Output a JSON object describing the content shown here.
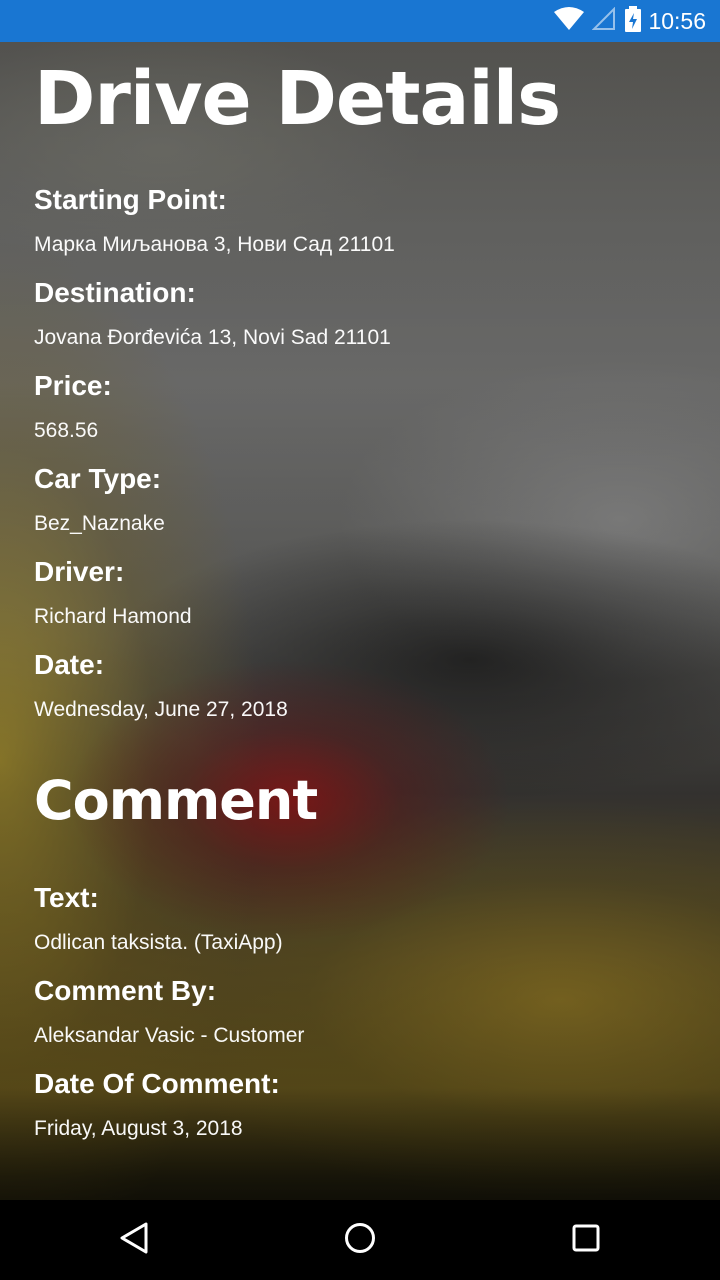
{
  "status_bar": {
    "time": "10:56",
    "icons": [
      "wifi-icon",
      "cellular-signal-icon",
      "battery-charging-icon"
    ]
  },
  "page": {
    "title": "Drive Details"
  },
  "drive": {
    "starting_point": {
      "label": "Starting Point:",
      "value": "Марка Миљанова 3, Нови Сад 21101"
    },
    "destination": {
      "label": "Destination:",
      "value": "Jovana Đorđevića 13, Novi Sad 21101"
    },
    "price": {
      "label": "Price:",
      "value": "568.56"
    },
    "car_type": {
      "label": "Car Type:",
      "value": "Bez_Naznake"
    },
    "driver": {
      "label": "Driver:",
      "value": "Richard Hamond"
    },
    "date": {
      "label": "Date:",
      "value": "Wednesday, June 27, 2018"
    }
  },
  "comment": {
    "title": "Comment",
    "text": {
      "label": "Text:",
      "value": "Odlican taksista. (TaxiApp)"
    },
    "by": {
      "label": "Comment By:",
      "value": "Aleksandar Vasic - Customer"
    },
    "date": {
      "label": "Date Of Comment:",
      "value": "Friday, August 3, 2018"
    }
  },
  "nav_bar": {
    "icons": [
      "back-icon",
      "home-icon",
      "recents-icon"
    ]
  },
  "colors": {
    "status_bar": "#1976d2",
    "nav_bar": "#000000",
    "text": "#ffffff"
  }
}
